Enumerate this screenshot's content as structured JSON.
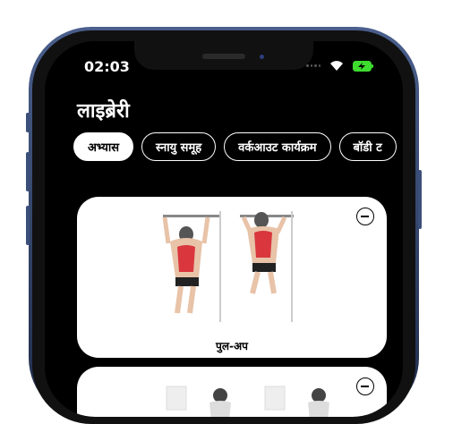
{
  "status_bar": {
    "time": "02:03"
  },
  "header": {
    "title": "लाइब्रेरी"
  },
  "tabs": [
    {
      "label": "अभ्यास",
      "active": true
    },
    {
      "label": "स्नायु समूह",
      "active": false
    },
    {
      "label": "वर्कआउट कार्यक्रम",
      "active": false
    },
    {
      "label": "बॉडी ट",
      "active": false
    }
  ],
  "exercises": [
    {
      "name": "पुल-अप",
      "icon": "remove-icon"
    },
    {
      "name": "",
      "icon": "remove-icon"
    }
  ],
  "colors": {
    "accent": "#ffffff",
    "battery": "#3ddc2e",
    "muscle_highlight": "#d9363e"
  }
}
